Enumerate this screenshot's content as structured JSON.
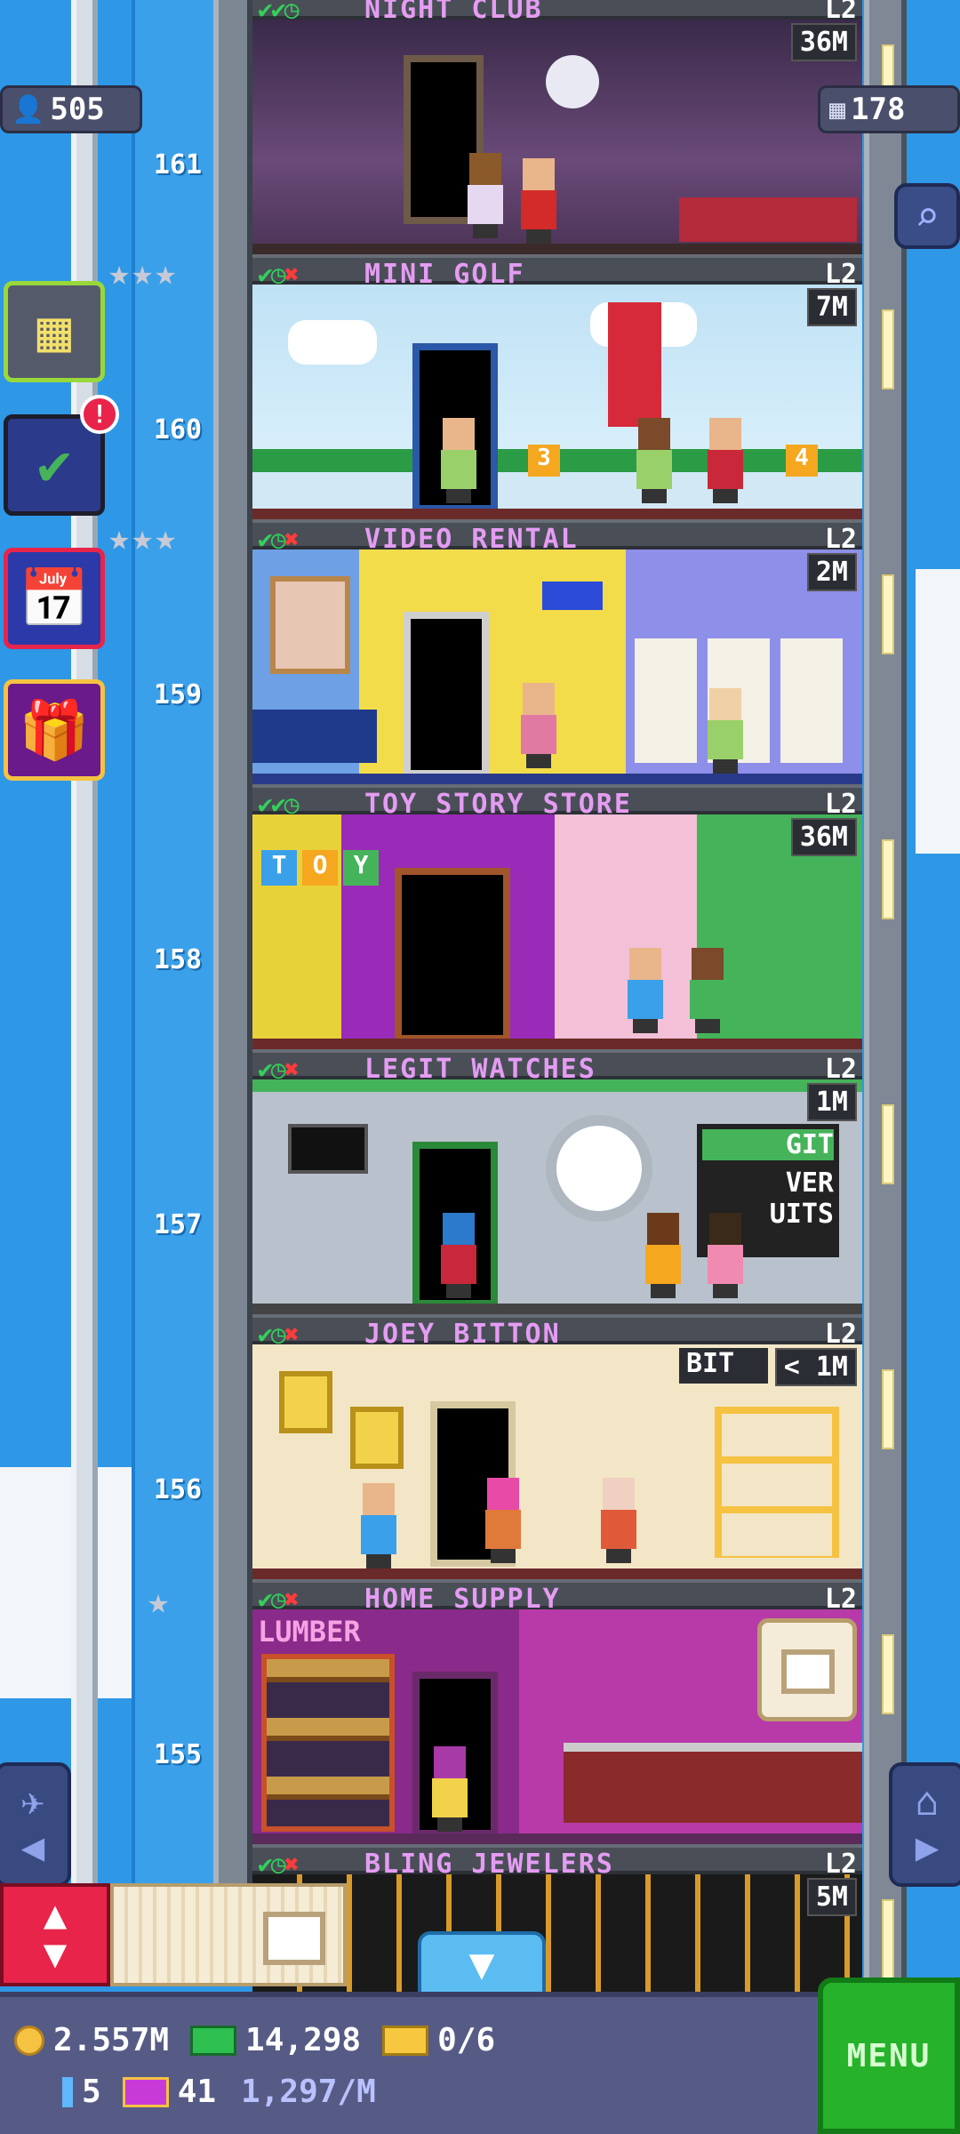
{
  "hud_top": {
    "population": "505",
    "floors": "178"
  },
  "ruler_labels": [
    "161",
    "160",
    "159",
    "158",
    "157",
    "156",
    "155"
  ],
  "floors": [
    {
      "name": "NIGHT CLUB",
      "level": "L2",
      "price": "36M",
      "status": "✔✔◷",
      "has_x": false
    },
    {
      "name": "MINI GOLF",
      "level": "L2",
      "price": "7M",
      "status": "✔◷",
      "has_x": true
    },
    {
      "name": "VIDEO RENTAL",
      "level": "L2",
      "price": "2M",
      "status": "✔◷",
      "has_x": true
    },
    {
      "name": "TOY STORY STORE",
      "level": "L2",
      "price": "36M",
      "status": "✔✔◷",
      "has_x": false
    },
    {
      "name": "LEGIT WATCHES",
      "level": "L2",
      "price": "1M",
      "status": "✔◷",
      "has_x": true
    },
    {
      "name": "JOEY BITTON",
      "level": "L2",
      "price": "< 1M",
      "status": "✔◷",
      "has_x": true
    },
    {
      "name": "HOME SUPPLY",
      "level": "L2",
      "price": "",
      "status": "✔◷",
      "has_x": true
    },
    {
      "name": "BLING JEWELERS",
      "level": "L2",
      "price": "5M",
      "status": "✔◷",
      "has_x": true
    }
  ],
  "signs": {
    "toy": [
      "T",
      "O",
      "Y"
    ],
    "lumber": "LUMBER",
    "golf_holes": [
      "3",
      "4"
    ],
    "watches_sign": [
      "GIT",
      "VER",
      "UITS"
    ],
    "bit": "BIT"
  },
  "hud": {
    "coins": "2.557M",
    "bux": "14,298",
    "tickets": "0/6",
    "bitizens": "5",
    "vip": "41",
    "rate": "1,297/M",
    "menu": "MENU"
  },
  "icons": {
    "population": "person-icon",
    "floors": "building-icon",
    "search": "magnifier-icon",
    "side_buttons": [
      "tower-overview-icon",
      "mission-checklist-icon",
      "calendar-icon",
      "gift-icon"
    ],
    "notification": "!"
  },
  "colors": {
    "sky": "#2e97e6",
    "floor_name": "#e59cf3",
    "menu_green": "#26b22b",
    "elevator_red": "#e8244a",
    "hud_bg": "#565b86"
  }
}
